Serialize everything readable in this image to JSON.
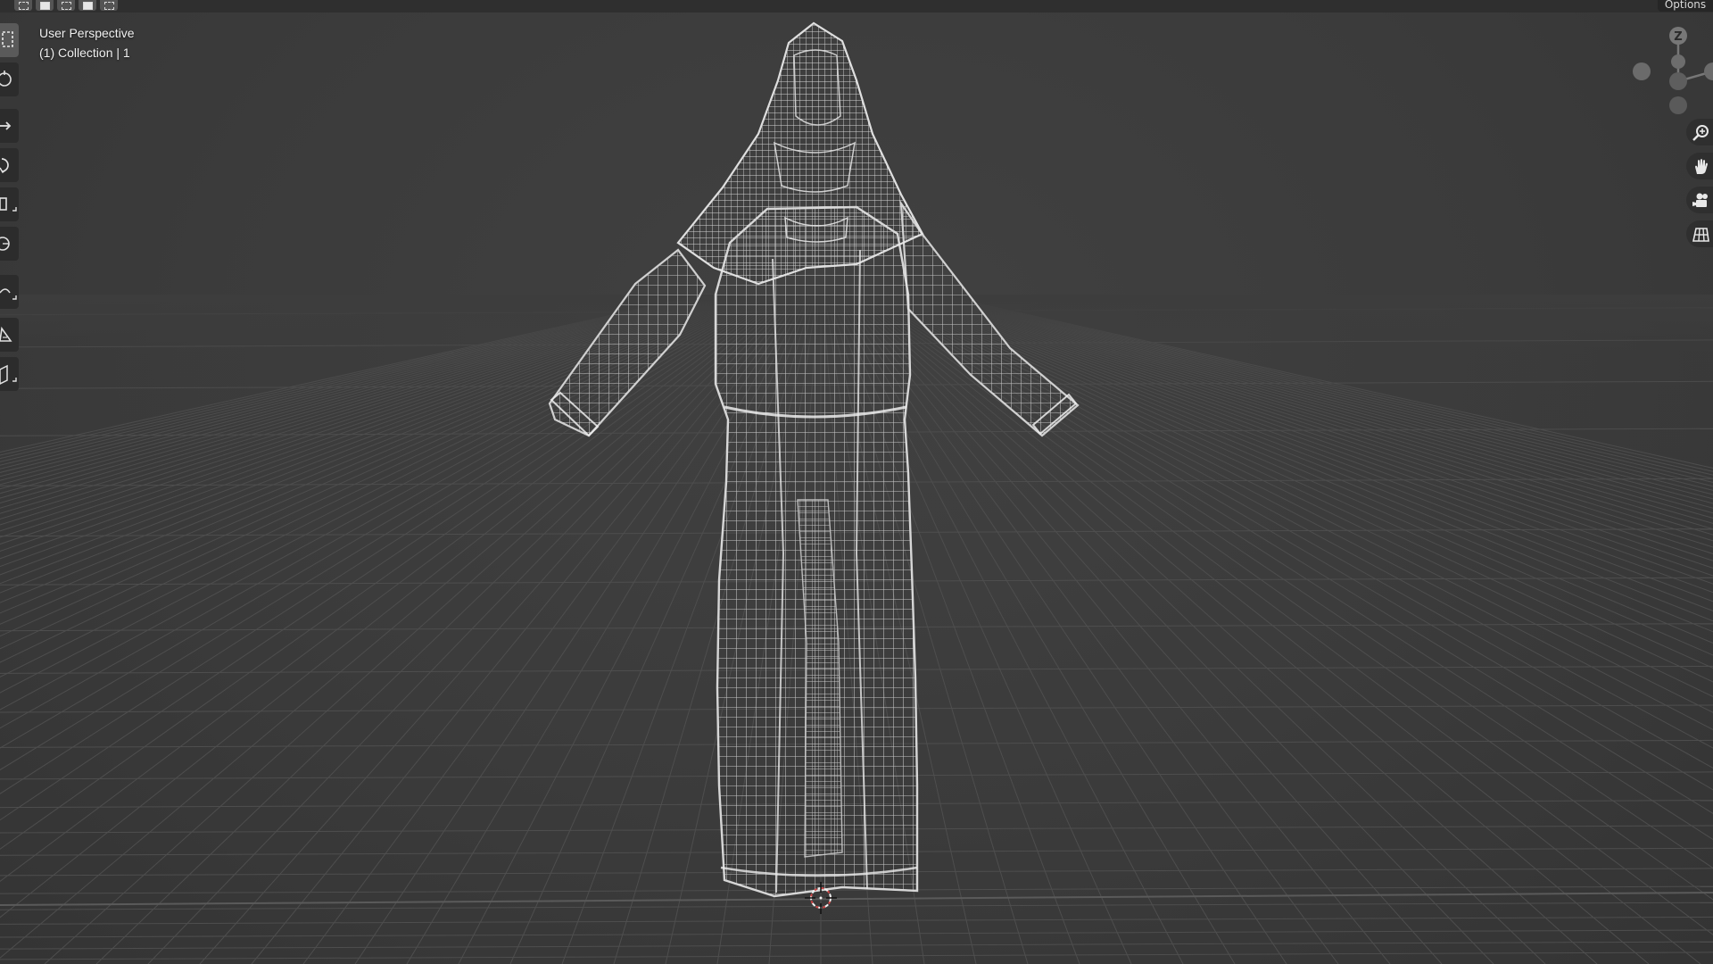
{
  "viewport": {
    "view_name": "User Perspective",
    "collection_info": "(1) Collection | 1"
  },
  "header": {
    "options_label": "Options",
    "selection_modes": [
      "select-box",
      "select-new",
      "select-extend",
      "select-subtract",
      "select-intersect"
    ]
  },
  "toolbar": {
    "tools": [
      "select-box-icon",
      "cursor-icon",
      "move-icon",
      "rotate-icon",
      "scale-icon",
      "transform-icon",
      "annotate-icon",
      "measure-icon",
      "add-cube-icon"
    ]
  },
  "gizmo": {
    "z_label": "Z",
    "nav_tools": [
      "zoom-icon",
      "hand-pan-icon",
      "camera-icon",
      "grid-perspective-icon"
    ]
  },
  "colors": {
    "background": "#3d3d3d",
    "grid_line": "#4e4e4e",
    "wire": "#d6d6d6",
    "text": "#f0f0f0"
  }
}
